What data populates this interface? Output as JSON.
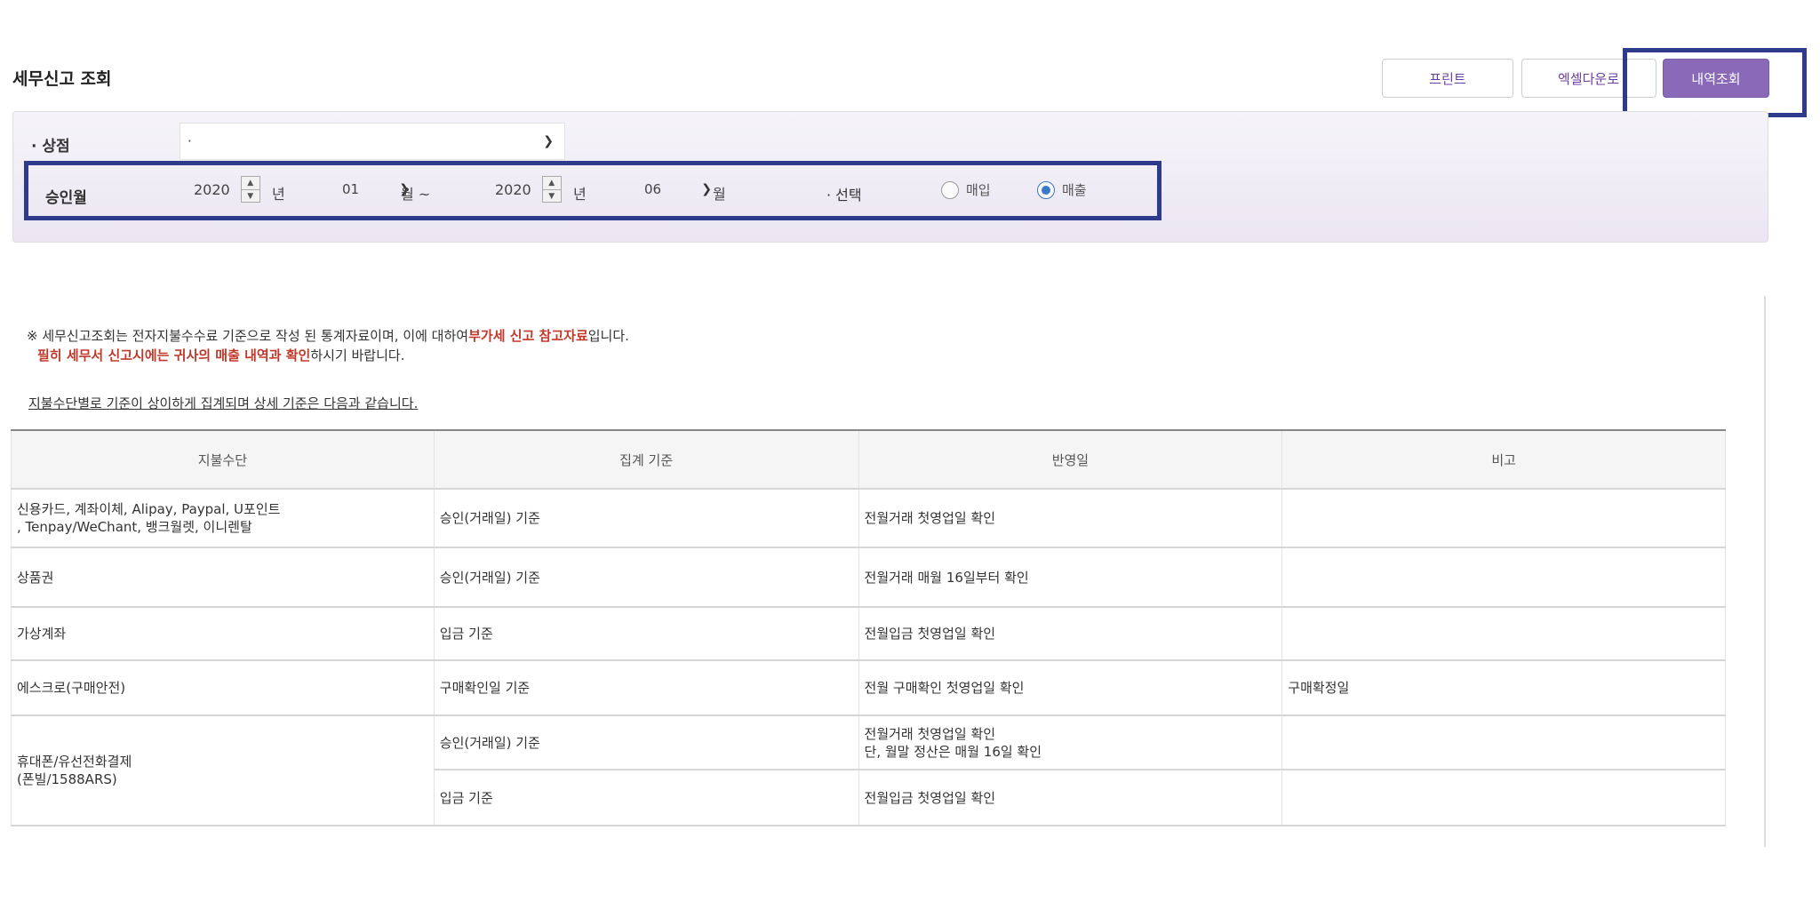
{
  "page": {
    "title": "세무신고 조회"
  },
  "toolbar": {
    "print_label": "프린트",
    "excel_label": "엑셀다운로",
    "search_label": "내역조회"
  },
  "filters": {
    "store_label": "· 상점",
    "store_value": "·",
    "approval_label": "승인월",
    "start_year": "2020",
    "start_month": "01",
    "end_year": "2020",
    "end_month": "06",
    "year_unit": "년",
    "month_unit": "월",
    "month_unit_range": "월 ~",
    "select_label": "· 선택",
    "radio_purchase": "매입",
    "radio_sales": "매출",
    "selected": "매출"
  },
  "notice": {
    "line1_a": "※ 세무신고조회는 전자지불수수료 기준으로 작성 된 통계자료이며, 이에 대하여",
    "line1_b": "부가세 신고 참고자료",
    "line1_c": "입니다.",
    "line2_a": "필히 세무서 신고시에는 귀사의 매출 내역과 확인",
    "line2_b": "하시기 바랍니다.",
    "line3": "지불수단별로 기준이 상이하게 집계되며 상세 기준은 다음과 같습니다."
  },
  "table": {
    "headers": [
      "지불수단",
      "집계 기준",
      "반영일",
      "비고"
    ],
    "rows": [
      {
        "method": "신용카드, 계좌이체, Alipay, Paypal, U포인트\n, Tenpay/WeChant, 뱅크월렛, 이니렌탈",
        "basis": "승인(거래일) 기준",
        "date": "전월거래 첫영업일 확인",
        "note": ""
      },
      {
        "method": "상품권",
        "basis": "승인(거래일) 기준",
        "date": "전월거래 매월 16일부터 확인",
        "note": ""
      },
      {
        "method": "가상계좌",
        "basis": "입금 기준",
        "date": "전월입금 첫영업일 확인",
        "note": ""
      },
      {
        "method": "에스크로(구매안전)",
        "basis": "구매확인일 기준",
        "date": "전월 구매확인 첫영업일 확인",
        "note": "구매확정일"
      },
      {
        "method": "휴대폰/유선전화결제\n(폰빌/1588ARS)",
        "basis": "승인(거래일) 기준",
        "date": "전월거래 첫영업일 확인\n단, 월말 정산은 매월 16일 확인",
        "note": ""
      },
      {
        "method": "",
        "basis": "입금 기준",
        "date": "전월입금 첫영업일 확인",
        "note": ""
      }
    ]
  }
}
